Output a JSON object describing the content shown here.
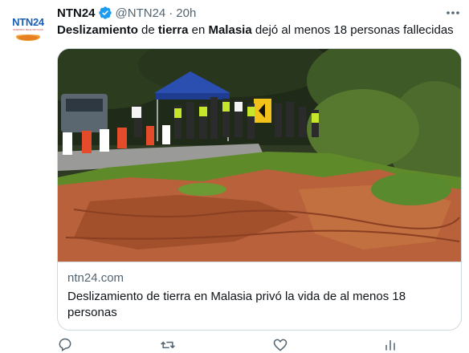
{
  "account": {
    "name": "NTN24",
    "handle": "@NTN24",
    "separator": "·",
    "time": "20h",
    "verified_icon": "verified-badge-icon",
    "avatar": {
      "logo": "NTN24",
      "tagline": "NUESTRA TELE NOTICIAS"
    }
  },
  "tweet": {
    "segments": [
      {
        "text": "Deslizamiento",
        "bold": true
      },
      {
        "text": " de ",
        "bold": false
      },
      {
        "text": "tierra",
        "bold": true
      },
      {
        "text": " en ",
        "bold": false
      },
      {
        "text": "Malasia",
        "bold": true
      },
      {
        "text": " dejó al menos 18 personas fallecidas",
        "bold": false
      }
    ]
  },
  "card": {
    "image_alt": "landslide scene with people and a tent near a collapsed road edge",
    "domain": "ntn24.com",
    "title": "Deslizamiento de tierra en Malasia privó la vida de al menos 18 personas"
  },
  "actions": {
    "icons": [
      "reply-icon",
      "retweet-icon",
      "like-icon",
      "views-icon"
    ]
  },
  "colors": {
    "text": "#0f1419",
    "secondary": "#536471",
    "border": "#cfd9de",
    "verified": "#1d9bf0"
  }
}
